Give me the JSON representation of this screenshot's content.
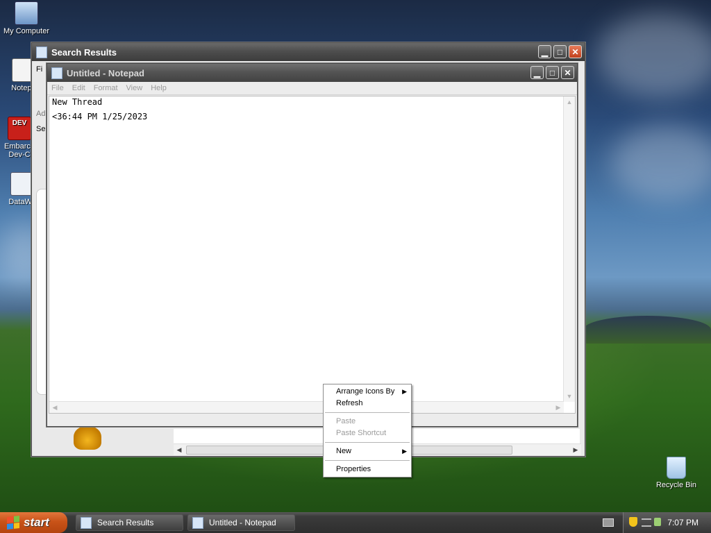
{
  "desktop": {
    "icons": [
      {
        "label": "My Computer",
        "icon": "my-computer-icon"
      },
      {
        "label": "Notepa",
        "icon": "notepad-shortcut-icon"
      },
      {
        "label": "Embarca",
        "label2": "Dev-C",
        "icon": "embarcadero-devc-icon"
      },
      {
        "label": "DataWa",
        "icon": "datawatch-icon"
      },
      {
        "label": "Recycle Bin",
        "icon": "recycle-bin-icon"
      }
    ]
  },
  "search_window": {
    "title": "Search Results",
    "partial_menu": "Fi",
    "partial_address": "Ad",
    "partial_search": "Se"
  },
  "notepad": {
    "title": "Untitled - Notepad",
    "menu": [
      "File",
      "Edit",
      "Format",
      "View",
      "Help"
    ],
    "lines": [
      "New Thread",
      "",
      "<36:44 PM 1/25/2023"
    ]
  },
  "context_menu": {
    "items": [
      {
        "label": "Arrange Icons By",
        "submenu": true,
        "disabled": false
      },
      {
        "label": "Refresh",
        "submenu": false,
        "disabled": false
      },
      {
        "label": "Paste",
        "submenu": false,
        "disabled": true
      },
      {
        "label": "Paste Shortcut",
        "submenu": false,
        "disabled": true
      },
      {
        "label": "New",
        "submenu": true,
        "disabled": false
      },
      {
        "label": "Properties",
        "submenu": false,
        "disabled": false
      }
    ]
  },
  "taskbar": {
    "start_label": "start",
    "buttons": [
      {
        "label": "Search Results",
        "icon": "search-results-icon"
      },
      {
        "label": "Untitled - Notepad",
        "icon": "notepad-icon"
      }
    ],
    "clock": "7:07 PM",
    "tray_icons": [
      "keyboard-icon",
      "security-shield-icon",
      "network-icon",
      "volume-icon"
    ]
  },
  "colors": {
    "start_orange": "#c95318",
    "title_gray": "#4e4e4e",
    "close_red": "#c2401c"
  }
}
